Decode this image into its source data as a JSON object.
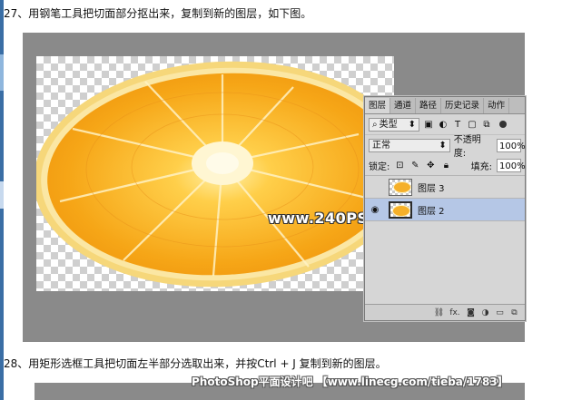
{
  "captions": {
    "step27": "27、用钢笔工具把切面部分抠出来，复制到新的图层，如下图。",
    "step28": "28、用矩形选框工具把切面左半部分选取出来，并按Ctrl + J 复制到新的图层。"
  },
  "watermark": "www.240PS.com",
  "footer_watermark": "PhotoShop平面设计吧 【www.linecg.com/tieba/1783】",
  "layers_panel": {
    "tabs": [
      "图层",
      "通道",
      "路径",
      "历史记录",
      "动作"
    ],
    "active_tab": "图层",
    "filter": {
      "label": "类型",
      "icon": "search-icon"
    },
    "blend_mode": "正常",
    "opacity_label": "不透明度:",
    "opacity_value": "100%",
    "lock_label": "锁定:",
    "fill_label": "填充:",
    "fill_value": "100%",
    "layers": [
      {
        "name": "图层 3",
        "visible": false,
        "selected": false
      },
      {
        "name": "图层 2",
        "visible": true,
        "selected": true
      }
    ],
    "eye_glyph": "◉",
    "bottom_icons": [
      "link-icon",
      "fx-icon",
      "mask-icon",
      "adjustment-icon",
      "folder-icon",
      "new-layer-icon"
    ],
    "fx_label": "fx."
  },
  "colors": {
    "stage_bg": "#8a8a8a",
    "selected_layer": "#b5c7e6",
    "orange_peel": "#f3a515"
  }
}
